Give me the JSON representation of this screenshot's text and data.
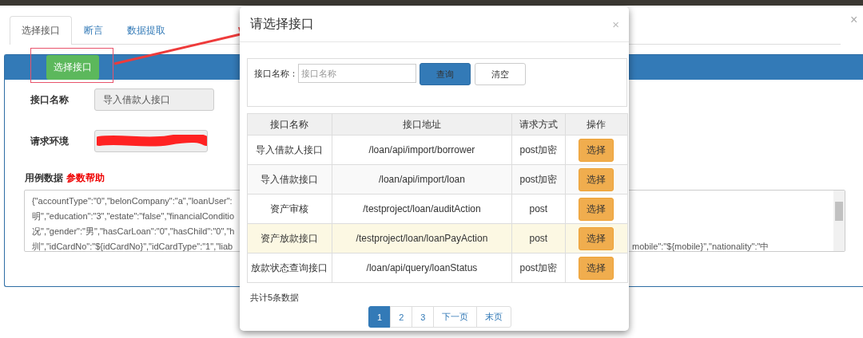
{
  "tabs": [
    {
      "label": "选择接口",
      "selected": true
    },
    {
      "label": "断言",
      "selected": false
    },
    {
      "label": "数据提取",
      "selected": false
    }
  ],
  "form": {
    "select_button": "选择接口",
    "fields": [
      {
        "label": "接口名称",
        "value": "导入借款人接口",
        "redacted": false
      },
      {
        "label": "请求环境",
        "redacted": true
      }
    ],
    "case_data_label": "用例数据",
    "param_help_link": "参数帮助",
    "case_data_lines": [
      "{\"accountType\":\"0\",\"belonCompany\":\"a\",\"loanUser\":",
      "明\",\"education\":\"3\",\"estate\":\"false\",\"financialConditio",
      "况\",\"gender\":\"男\",\"hasCarLoan\":\"0\",\"hasChild\":\"0\",\"h",
      "圳\",\"idCardNo\":\"${idCardNo}\",\"idCardType\":\"1\",\"liab"
    ],
    "case_data_fragment": "mobile\":\"${mobile}\",\"nationality\":\"中"
  },
  "annotation": {
    "highlight_box": true,
    "arrow": true
  },
  "modal": {
    "title": "请选择接口",
    "close": "×",
    "search": {
      "label": "接口名称：",
      "placeholder": "接口名称",
      "buttons": [
        {
          "label": "查询",
          "kind": "primary"
        },
        {
          "label": "清空",
          "kind": "default"
        }
      ]
    },
    "table": {
      "columns": [
        "接口名称",
        "接口地址",
        "请求方式",
        "操作"
      ],
      "rows": [
        {
          "name": "导入借款人接口",
          "path": "/loan/api/import/borrower",
          "method": "post加密",
          "action": "选择",
          "highlighted": false
        },
        {
          "name": "导入借款接口",
          "path": "/loan/api/import/loan",
          "method": "post加密",
          "action": "选择",
          "highlighted": false
        },
        {
          "name": "资产审核",
          "path": "/testproject/loan/auditAction",
          "method": "post",
          "action": "选择",
          "highlighted": false
        },
        {
          "name": "资产放款接口",
          "path": "/testproject/loan/loanPayAction",
          "method": "post",
          "action": "选择",
          "highlighted": true
        },
        {
          "name": "放款状态查询接口",
          "path": "/loan/api/query/loanStatus",
          "method": "post加密",
          "action": "选择",
          "highlighted": false
        }
      ]
    },
    "total": "共计5条数据",
    "pagination": [
      {
        "label": "1",
        "selected": true
      },
      {
        "label": "2",
        "selected": false
      },
      {
        "label": "3",
        "selected": false
      },
      {
        "label": "下一页",
        "selected": false
      },
      {
        "label": "末页",
        "selected": false
      }
    ]
  },
  "page_close": "×"
}
